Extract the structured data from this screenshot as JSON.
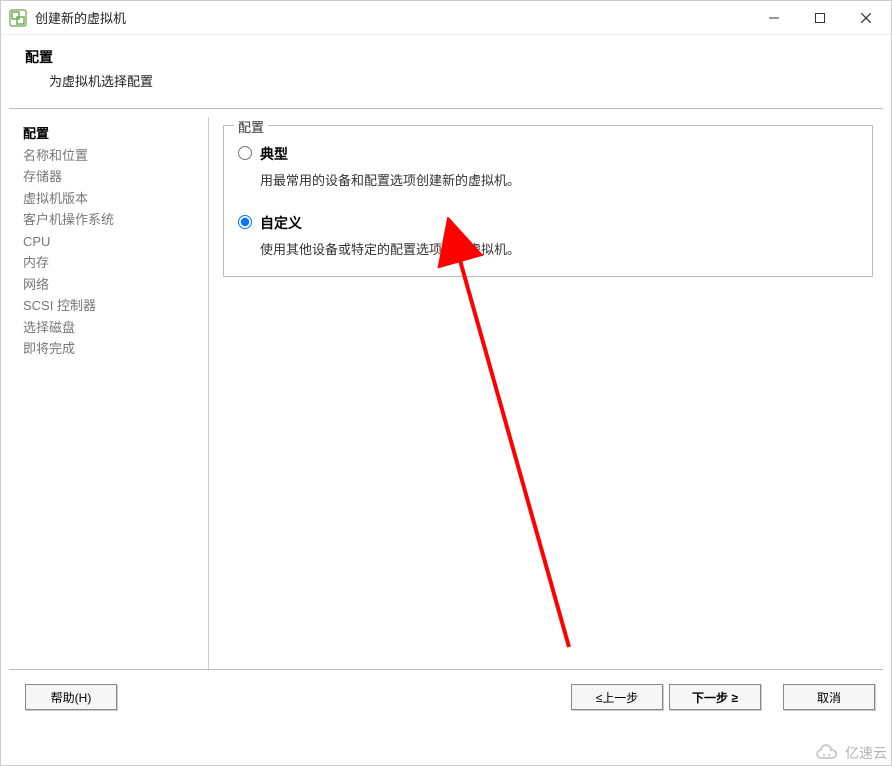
{
  "window": {
    "title": "创建新的虚拟机"
  },
  "header": {
    "title": "配置",
    "subtitle": "为虚拟机选择配置"
  },
  "sidebar": {
    "steps": [
      "配置",
      "名称和位置",
      "存储器",
      "虚拟机版本",
      "客户机操作系统",
      "CPU",
      "内存",
      "网络",
      "SCSI 控制器",
      "选择磁盘",
      "即将完成"
    ],
    "activeIndex": 0
  },
  "configGroup": {
    "legend": "配置",
    "options": {
      "typical": {
        "label": "典型",
        "desc": "用最常用的设备和配置选项创建新的虚拟机。",
        "selected": false
      },
      "custom": {
        "label": "自定义",
        "desc": "使用其他设备或特定的配置选项创建虚拟机。",
        "selected": true
      }
    }
  },
  "footer": {
    "help": "帮助(H)",
    "back": "≤上一步",
    "next": "下一步 ≥",
    "cancel": "取消"
  },
  "watermark": "亿速云",
  "colors": {
    "arrow": "#ff0000",
    "border": "#bbbbbb",
    "textMuted": "#777777"
  }
}
